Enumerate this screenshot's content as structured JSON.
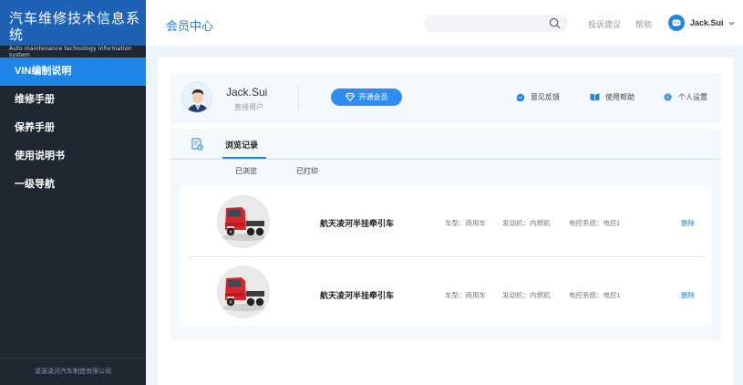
{
  "sidebar": {
    "brand_title": "汽车维修技术信息系统",
    "brand_sub": "Auto maintenance technology information system",
    "items": [
      {
        "label": "VIN编制说明",
        "active": true
      },
      {
        "label": "维修手册",
        "active": false
      },
      {
        "label": "保养手册",
        "active": false
      },
      {
        "label": "使用说明书",
        "active": false
      },
      {
        "label": "一级导航",
        "active": false
      }
    ],
    "footer": "凌源凌河汽车制造有限公司"
  },
  "header": {
    "title": "会员中心",
    "search_placeholder": "",
    "links": [
      "投诉建议",
      "帮助"
    ],
    "username": "Jack.Sui"
  },
  "profile": {
    "name": "Jack.Sui",
    "role": "直接用户",
    "vip_button": "开通会员",
    "actions": [
      {
        "label": "意见反馈",
        "icon": "feedback-icon"
      },
      {
        "label": "使用帮助",
        "icon": "book-icon"
      },
      {
        "label": "个人设置",
        "icon": "gear-icon"
      }
    ]
  },
  "tabs": {
    "main_label": "浏览记录",
    "subtabs": [
      "已浏览",
      "已打印"
    ],
    "active_subtab": "已浏览"
  },
  "records": [
    {
      "name": "航天凌河半挂牵引车",
      "type": "车型：商用车",
      "engine": "发动机：内燃机",
      "ecu": "电控系统：电控1",
      "delete_label": "删除"
    },
    {
      "name": "航天凌河半挂牵引车",
      "type": "车型：商用车",
      "engine": "发动机：内燃机",
      "ecu": "电控系统：电控1",
      "delete_label": "删除"
    }
  ],
  "colors": {
    "accent": "#1e86e8",
    "brand_bg": "#1e62b5",
    "sidebar_bg": "#1f2733",
    "page_bg": "#eef4fb",
    "panel_bg": "#f4f9fe",
    "truck_red": "#d8262b"
  }
}
